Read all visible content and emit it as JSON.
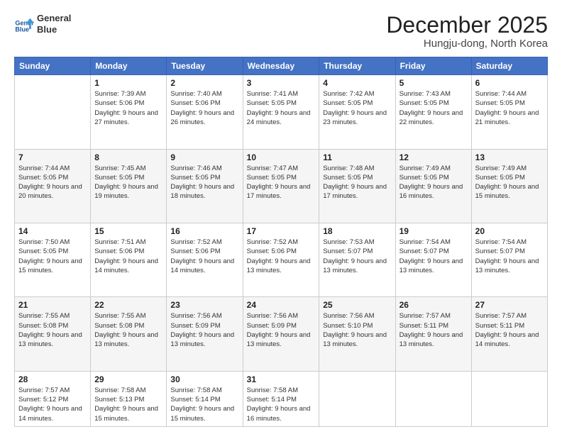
{
  "header": {
    "logo_line1": "General",
    "logo_line2": "Blue",
    "month": "December 2025",
    "location": "Hungju-dong, North Korea"
  },
  "weekdays": [
    "Sunday",
    "Monday",
    "Tuesday",
    "Wednesday",
    "Thursday",
    "Friday",
    "Saturday"
  ],
  "weeks": [
    [
      {
        "day": "",
        "sunrise": "",
        "sunset": "",
        "daylight": ""
      },
      {
        "day": "1",
        "sunrise": "Sunrise: 7:39 AM",
        "sunset": "Sunset: 5:06 PM",
        "daylight": "Daylight: 9 hours and 27 minutes."
      },
      {
        "day": "2",
        "sunrise": "Sunrise: 7:40 AM",
        "sunset": "Sunset: 5:06 PM",
        "daylight": "Daylight: 9 hours and 26 minutes."
      },
      {
        "day": "3",
        "sunrise": "Sunrise: 7:41 AM",
        "sunset": "Sunset: 5:05 PM",
        "daylight": "Daylight: 9 hours and 24 minutes."
      },
      {
        "day": "4",
        "sunrise": "Sunrise: 7:42 AM",
        "sunset": "Sunset: 5:05 PM",
        "daylight": "Daylight: 9 hours and 23 minutes."
      },
      {
        "day": "5",
        "sunrise": "Sunrise: 7:43 AM",
        "sunset": "Sunset: 5:05 PM",
        "daylight": "Daylight: 9 hours and 22 minutes."
      },
      {
        "day": "6",
        "sunrise": "Sunrise: 7:44 AM",
        "sunset": "Sunset: 5:05 PM",
        "daylight": "Daylight: 9 hours and 21 minutes."
      }
    ],
    [
      {
        "day": "7",
        "sunrise": "Sunrise: 7:44 AM",
        "sunset": "Sunset: 5:05 PM",
        "daylight": "Daylight: 9 hours and 20 minutes."
      },
      {
        "day": "8",
        "sunrise": "Sunrise: 7:45 AM",
        "sunset": "Sunset: 5:05 PM",
        "daylight": "Daylight: 9 hours and 19 minutes."
      },
      {
        "day": "9",
        "sunrise": "Sunrise: 7:46 AM",
        "sunset": "Sunset: 5:05 PM",
        "daylight": "Daylight: 9 hours and 18 minutes."
      },
      {
        "day": "10",
        "sunrise": "Sunrise: 7:47 AM",
        "sunset": "Sunset: 5:05 PM",
        "daylight": "Daylight: 9 hours and 17 minutes."
      },
      {
        "day": "11",
        "sunrise": "Sunrise: 7:48 AM",
        "sunset": "Sunset: 5:05 PM",
        "daylight": "Daylight: 9 hours and 17 minutes."
      },
      {
        "day": "12",
        "sunrise": "Sunrise: 7:49 AM",
        "sunset": "Sunset: 5:05 PM",
        "daylight": "Daylight: 9 hours and 16 minutes."
      },
      {
        "day": "13",
        "sunrise": "Sunrise: 7:49 AM",
        "sunset": "Sunset: 5:05 PM",
        "daylight": "Daylight: 9 hours and 15 minutes."
      }
    ],
    [
      {
        "day": "14",
        "sunrise": "Sunrise: 7:50 AM",
        "sunset": "Sunset: 5:05 PM",
        "daylight": "Daylight: 9 hours and 15 minutes."
      },
      {
        "day": "15",
        "sunrise": "Sunrise: 7:51 AM",
        "sunset": "Sunset: 5:06 PM",
        "daylight": "Daylight: 9 hours and 14 minutes."
      },
      {
        "day": "16",
        "sunrise": "Sunrise: 7:52 AM",
        "sunset": "Sunset: 5:06 PM",
        "daylight": "Daylight: 9 hours and 14 minutes."
      },
      {
        "day": "17",
        "sunrise": "Sunrise: 7:52 AM",
        "sunset": "Sunset: 5:06 PM",
        "daylight": "Daylight: 9 hours and 13 minutes."
      },
      {
        "day": "18",
        "sunrise": "Sunrise: 7:53 AM",
        "sunset": "Sunset: 5:07 PM",
        "daylight": "Daylight: 9 hours and 13 minutes."
      },
      {
        "day": "19",
        "sunrise": "Sunrise: 7:54 AM",
        "sunset": "Sunset: 5:07 PM",
        "daylight": "Daylight: 9 hours and 13 minutes."
      },
      {
        "day": "20",
        "sunrise": "Sunrise: 7:54 AM",
        "sunset": "Sunset: 5:07 PM",
        "daylight": "Daylight: 9 hours and 13 minutes."
      }
    ],
    [
      {
        "day": "21",
        "sunrise": "Sunrise: 7:55 AM",
        "sunset": "Sunset: 5:08 PM",
        "daylight": "Daylight: 9 hours and 13 minutes."
      },
      {
        "day": "22",
        "sunrise": "Sunrise: 7:55 AM",
        "sunset": "Sunset: 5:08 PM",
        "daylight": "Daylight: 9 hours and 13 minutes."
      },
      {
        "day": "23",
        "sunrise": "Sunrise: 7:56 AM",
        "sunset": "Sunset: 5:09 PM",
        "daylight": "Daylight: 9 hours and 13 minutes."
      },
      {
        "day": "24",
        "sunrise": "Sunrise: 7:56 AM",
        "sunset": "Sunset: 5:09 PM",
        "daylight": "Daylight: 9 hours and 13 minutes."
      },
      {
        "day": "25",
        "sunrise": "Sunrise: 7:56 AM",
        "sunset": "Sunset: 5:10 PM",
        "daylight": "Daylight: 9 hours and 13 minutes."
      },
      {
        "day": "26",
        "sunrise": "Sunrise: 7:57 AM",
        "sunset": "Sunset: 5:11 PM",
        "daylight": "Daylight: 9 hours and 13 minutes."
      },
      {
        "day": "27",
        "sunrise": "Sunrise: 7:57 AM",
        "sunset": "Sunset: 5:11 PM",
        "daylight": "Daylight: 9 hours and 14 minutes."
      }
    ],
    [
      {
        "day": "28",
        "sunrise": "Sunrise: 7:57 AM",
        "sunset": "Sunset: 5:12 PM",
        "daylight": "Daylight: 9 hours and 14 minutes."
      },
      {
        "day": "29",
        "sunrise": "Sunrise: 7:58 AM",
        "sunset": "Sunset: 5:13 PM",
        "daylight": "Daylight: 9 hours and 15 minutes."
      },
      {
        "day": "30",
        "sunrise": "Sunrise: 7:58 AM",
        "sunset": "Sunset: 5:14 PM",
        "daylight": "Daylight: 9 hours and 15 minutes."
      },
      {
        "day": "31",
        "sunrise": "Sunrise: 7:58 AM",
        "sunset": "Sunset: 5:14 PM",
        "daylight": "Daylight: 9 hours and 16 minutes."
      },
      {
        "day": "",
        "sunrise": "",
        "sunset": "",
        "daylight": ""
      },
      {
        "day": "",
        "sunrise": "",
        "sunset": "",
        "daylight": ""
      },
      {
        "day": "",
        "sunrise": "",
        "sunset": "",
        "daylight": ""
      }
    ]
  ]
}
